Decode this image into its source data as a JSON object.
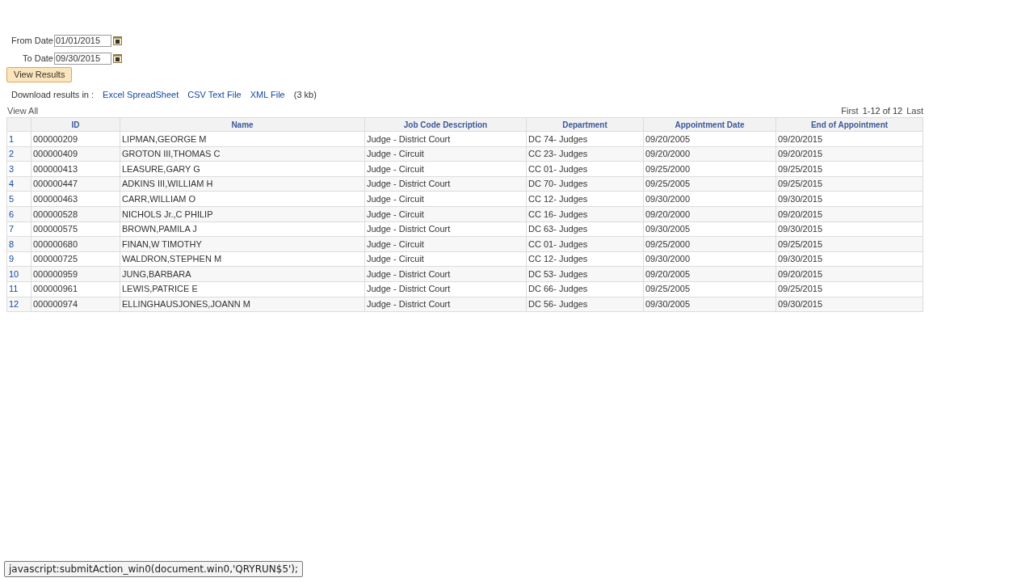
{
  "criteria": [
    {
      "label": "From Date",
      "value": "01/01/2015"
    },
    {
      "label": "To Date",
      "value": "09/30/2015"
    }
  ],
  "view_button": "View Results",
  "download": {
    "label": "Download results in :",
    "links": [
      "Excel SpreadSheet",
      "CSV Text File",
      "XML File"
    ],
    "size": "(3 kb)"
  },
  "view_all": "View All",
  "pager": {
    "first": "First",
    "range": "1-12 of 12",
    "last": "Last"
  },
  "table": {
    "columns": [
      "",
      "ID",
      "Name",
      "Job Code Description",
      "Department",
      "Appointment Date",
      "End of Appointment"
    ],
    "rows": [
      [
        "1",
        "000000209",
        "LIPMAN,GEORGE M",
        "Judge - District Court",
        "DC 74- Judges",
        "09/20/2005",
        "09/20/2015"
      ],
      [
        "2",
        "000000409",
        "GROTON III,THOMAS C",
        "Judge - Circuit",
        "CC 23- Judges",
        "09/20/2000",
        "09/20/2015"
      ],
      [
        "3",
        "000000413",
        "LEASURE,GARY G",
        "Judge - Circuit",
        "CC 01- Judges",
        "09/25/2000",
        "09/25/2015"
      ],
      [
        "4",
        "000000447",
        "ADKINS III,WILLIAM H",
        "Judge - District Court",
        "DC 70- Judges",
        "09/25/2005",
        "09/25/2015"
      ],
      [
        "5",
        "000000463",
        "CARR,WILLIAM O",
        "Judge - Circuit",
        "CC 12- Judges",
        "09/30/2000",
        "09/30/2015"
      ],
      [
        "6",
        "000000528",
        "NICHOLS Jr.,C PHILIP",
        "Judge - Circuit",
        "CC 16- Judges",
        "09/20/2000",
        "09/20/2015"
      ],
      [
        "7",
        "000000575",
        "BROWN,PAMILA J",
        "Judge - District Court",
        "DC 63- Judges",
        "09/30/2005",
        "09/30/2015"
      ],
      [
        "8",
        "000000680",
        "FINAN,W TIMOTHY",
        "Judge - Circuit",
        "CC 01- Judges",
        "09/25/2000",
        "09/25/2015"
      ],
      [
        "9",
        "000000725",
        "WALDRON,STEPHEN M",
        "Judge - Circuit",
        "CC 12- Judges",
        "09/30/2000",
        "09/30/2015"
      ],
      [
        "10",
        "000000959",
        "JUNG,BARBARA",
        "Judge - District Court",
        "DC 53- Judges",
        "09/20/2005",
        "09/20/2015"
      ],
      [
        "11",
        "000000961",
        "LEWIS,PATRICE E",
        "Judge - District Court",
        "DC 66- Judges",
        "09/25/2005",
        "09/25/2015"
      ],
      [
        "12",
        "000000974",
        "ELLINGHAUSJONES,JOANN M",
        "Judge - District Court",
        "DC 56- Judges",
        "09/30/2005",
        "09/30/2015"
      ]
    ]
  },
  "status_bar": "javascript:submitAction_win0(document.win0,'QRYRUN$5');"
}
